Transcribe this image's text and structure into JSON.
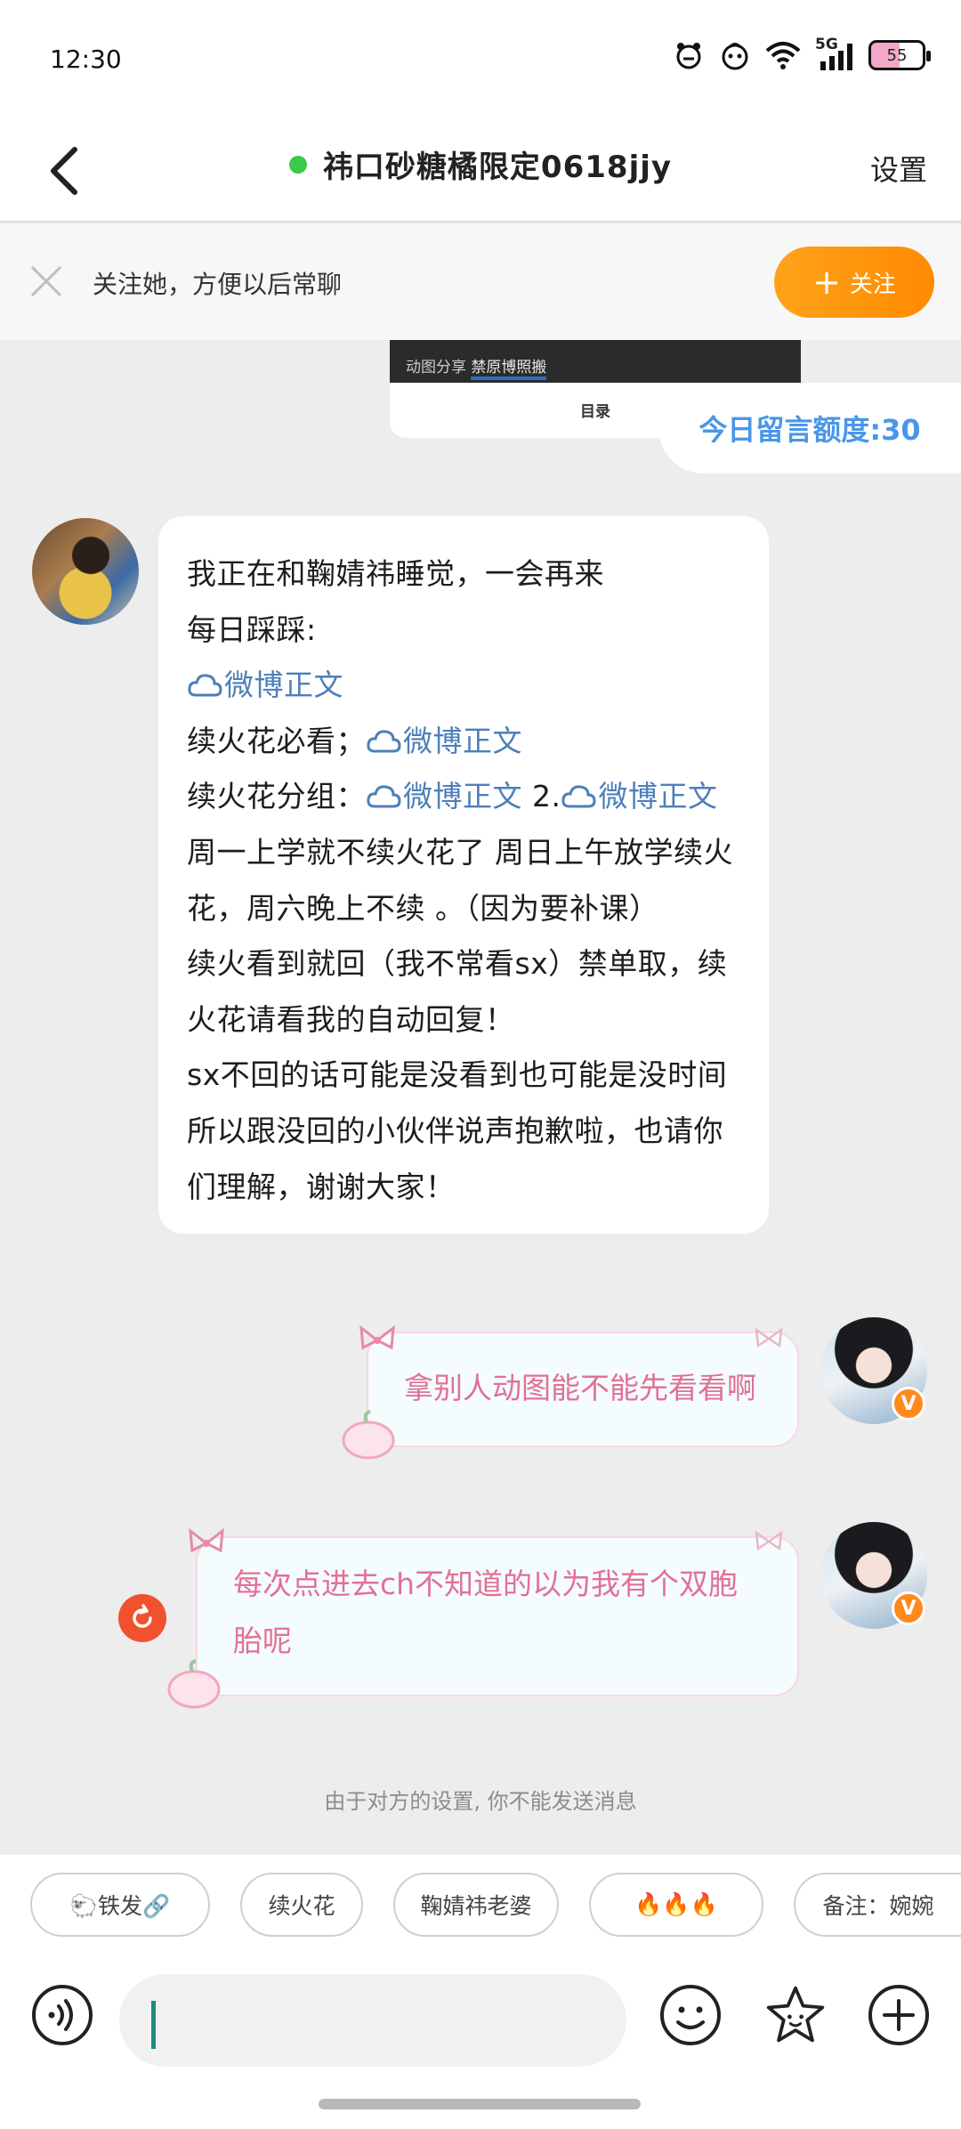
{
  "status_bar": {
    "time": "12:30",
    "network": "5G",
    "battery": "55"
  },
  "header": {
    "back_label": "",
    "title": "祎口砂糖橘限定0618jjy",
    "settings_label": "设置"
  },
  "follow_bar": {
    "text": "关注她，方便以后常聊",
    "button_label": "关注"
  },
  "shared_card": {
    "text_prefix": "动图分享 ",
    "text_highlight": "禁原博照搬",
    "footer": "目录"
  },
  "quota": {
    "label": "今日留言额度:30"
  },
  "incoming_message": {
    "lines": [
      [
        {
          "t": "我正在和鞠婧祎睡觉，一会再来"
        }
      ],
      [
        {
          "t": "每日踩踩:"
        }
      ],
      [
        {
          "t": "微博正文",
          "link": true
        }
      ],
      [
        {
          "t": "续火花必看；"
        },
        {
          "t": "微博正文",
          "link": true
        }
      ],
      [
        {
          "t": "续火花分组："
        },
        {
          "t": "微博正文",
          "link": true
        },
        {
          "t": "  2."
        },
        {
          "t": "微博正文",
          "link": true
        }
      ],
      [
        {
          "t": "周一上学就不续火花了 周日上午放学续火"
        }
      ],
      [
        {
          "t": "花，周六晚上不续 。（因为要补课）"
        }
      ],
      [
        {
          "t": "续火看到就回（我不常看sx）禁单取，续"
        }
      ],
      [
        {
          "t": "火花请看我的自动回复！"
        }
      ],
      [
        {
          "t": "sx不回的话可能是没看到也可能是没时间"
        }
      ],
      [
        {
          "t": "所以跟没回的小伙伴说声抱歉啦，也请你"
        }
      ],
      [
        {
          "t": "们理解，谢谢大家！"
        }
      ]
    ]
  },
  "outgoing_messages": [
    {
      "lines": [
        "拿别人动图能不能先看看啊"
      ]
    },
    {
      "lines": [
        "每次点进去ch不知道的以为我有个双胞",
        "胎呢"
      ]
    }
  ],
  "badge_letter": "V",
  "notice": "由于对方的设置, 你不能发送消息",
  "chips": [
    {
      "label": "🐑铁发🔗"
    },
    {
      "label": "续火花"
    },
    {
      "label": "鞠婧祎老婆"
    },
    {
      "label": "🔥🔥🔥"
    },
    {
      "label": "备注：婉婉"
    }
  ],
  "input": {
    "placeholder": ""
  }
}
